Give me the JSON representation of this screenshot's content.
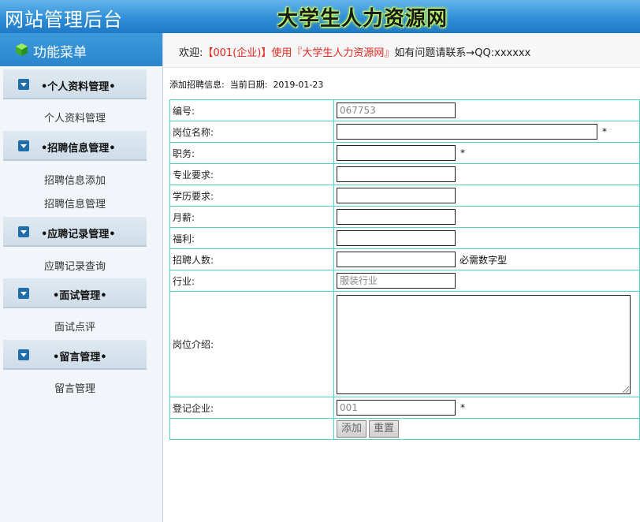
{
  "header": {
    "admin_title": "网站管理后台",
    "brand_title": "大学生人力资源网"
  },
  "sidebar": {
    "menu_title": "功能菜单",
    "groups": [
      {
        "label": "•个人资料管理•",
        "items": [
          "个人资料管理"
        ]
      },
      {
        "label": "•招聘信息管理•",
        "items": [
          "招聘信息添加",
          "招聘信息管理"
        ]
      },
      {
        "label": "•应聘记录管理•",
        "items": [
          "应聘记录查询"
        ]
      },
      {
        "label": "•面试管理•",
        "items": [
          "面试点评"
        ]
      },
      {
        "label": "•留言管理•",
        "items": [
          "留言管理"
        ]
      }
    ]
  },
  "welcome": {
    "prefix": "欢迎:",
    "user": "【001(企业)】",
    "use_label": "使用",
    "site": "『大学生人力资源网』",
    "contact": "如有问题请联系→QQ:xxxxxx"
  },
  "form": {
    "caption_label": "添加招聘信息:",
    "date_label": "当前日期:",
    "date_value": "2019-01-23",
    "fields": {
      "id": {
        "label": "编号:",
        "value": "067753"
      },
      "position": {
        "label": "岗位名称:",
        "value": ""
      },
      "duty": {
        "label": "职务:",
        "value": ""
      },
      "major": {
        "label": "专业要求:",
        "value": ""
      },
      "education": {
        "label": "学历要求:",
        "value": ""
      },
      "salary": {
        "label": "月薪:",
        "value": ""
      },
      "welfare": {
        "label": "福利:",
        "value": ""
      },
      "headcount": {
        "label": "招聘人数:",
        "value": "",
        "hint": "必需数字型"
      },
      "industry": {
        "label": "行业:",
        "value": "服装行业"
      },
      "intro": {
        "label": "岗位介绍:",
        "value": ""
      },
      "company": {
        "label": "登记企业:",
        "value": "001"
      }
    },
    "required_mark": "*",
    "add_button": "添加",
    "reset_button": "重置"
  }
}
